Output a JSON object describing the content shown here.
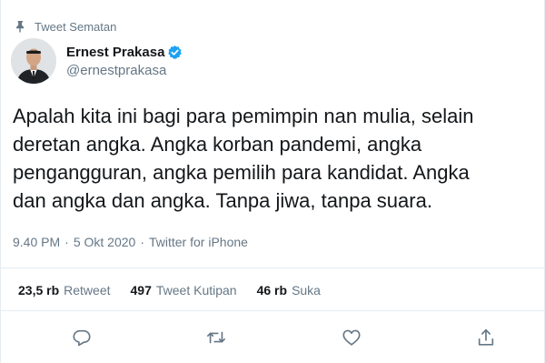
{
  "pinned": {
    "label": "Tweet Sematan",
    "icon": "pin-icon"
  },
  "author": {
    "display_name": "Ernest Prakasa",
    "handle": "@ernestprakasa",
    "verified": true,
    "avatar_icon": "avatar-photo"
  },
  "tweet": {
    "text": "Apalah kita ini bagi para pemimpin nan mulia, selain\nderetan angka. Angka korban pandemi, angka\npengangguran, angka pemilih para kandidat. Angka\ndan angka dan angka. Tanpa jiwa, tanpa suara."
  },
  "meta": {
    "time": "9.40 PM",
    "separator": "·",
    "date": "5 Okt 2020",
    "source": "Twitter for iPhone"
  },
  "stats": [
    {
      "count": "23,5 rb",
      "label": "Retweet"
    },
    {
      "count": "497",
      "label": "Tweet Kutipan"
    },
    {
      "count": "46 rb",
      "label": "Suka"
    }
  ],
  "actions": [
    "reply-icon",
    "retweet-icon",
    "like-icon",
    "share-icon"
  ],
  "colors": {
    "text_primary": "#14171a",
    "text_secondary": "#657786",
    "verified_blue": "#1da1f2",
    "divider": "#e6ecf0"
  }
}
